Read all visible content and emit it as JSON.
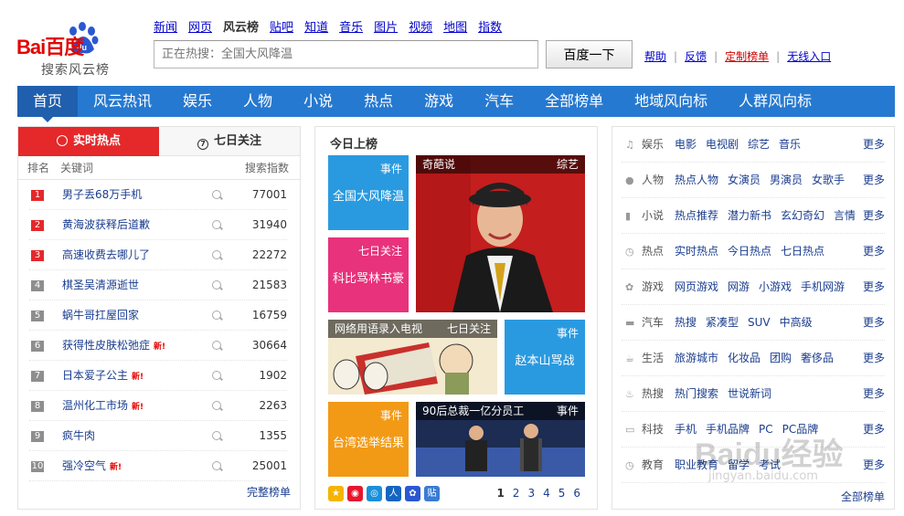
{
  "logo": {
    "word": "Bai百度",
    "sub": "搜索风云榜"
  },
  "topnav": [
    {
      "label": "新闻"
    },
    {
      "label": "网页"
    },
    {
      "label": "风云榜",
      "current": true
    },
    {
      "label": "贴吧"
    },
    {
      "label": "知道"
    },
    {
      "label": "音乐"
    },
    {
      "label": "图片"
    },
    {
      "label": "视频"
    },
    {
      "label": "地图"
    },
    {
      "label": "指数"
    }
  ],
  "search": {
    "placeholder": "正在热搜：全国大风降温",
    "button": "百度一下"
  },
  "toplinks": {
    "help": "帮助",
    "feedback": "反馈",
    "custom": "定制榜单",
    "wireless": "无线入口"
  },
  "mainnav": [
    {
      "label": "首页",
      "current": true
    },
    {
      "label": "风云热讯"
    },
    {
      "label": "娱乐"
    },
    {
      "label": "人物"
    },
    {
      "label": "小说"
    },
    {
      "label": "热点"
    },
    {
      "label": "游戏"
    },
    {
      "label": "汽车"
    },
    {
      "label": "全部榜单"
    },
    {
      "label": "地域风向标"
    },
    {
      "label": "人群风向标"
    }
  ],
  "hot": {
    "tabs": [
      "实时热点",
      "七日关注"
    ],
    "cols": {
      "rank": "排名",
      "keyword": "关键词",
      "index": "搜索指数"
    },
    "new_tag": "新!",
    "rows": [
      {
        "rank": "1",
        "kw": "男子丢68万手机",
        "val": "77001",
        "isNew": false
      },
      {
        "rank": "2",
        "kw": "黄海波获释后道歉",
        "val": "31940",
        "isNew": false
      },
      {
        "rank": "3",
        "kw": "高速收费去哪儿了",
        "val": "22272",
        "isNew": false
      },
      {
        "rank": "4",
        "kw": "棋圣吴清源逝世",
        "val": "21583",
        "isNew": false
      },
      {
        "rank": "5",
        "kw": "蜗牛哥扛屋回家",
        "val": "16759",
        "isNew": false
      },
      {
        "rank": "6",
        "kw": "获得性皮肤松弛症",
        "val": "30664",
        "isNew": true
      },
      {
        "rank": "7",
        "kw": "日本爱子公主",
        "val": "1902",
        "isNew": true
      },
      {
        "rank": "8",
        "kw": "温州化工市场",
        "val": "2263",
        "isNew": true
      },
      {
        "rank": "9",
        "kw": "疯牛肉",
        "val": "1355",
        "isNew": false
      },
      {
        "rank": "10",
        "kw": "强冷空气",
        "val": "25001",
        "isNew": true
      }
    ],
    "more": "完整榜单"
  },
  "today": {
    "title": "今日上榜",
    "tiles": [
      {
        "tag": "事件",
        "text": "全国大风降温",
        "color": "#2a9ae0"
      },
      {
        "tag": "七日关注",
        "text": "科比骂林书豪",
        "color": "#e8327c"
      },
      {
        "tag": "事件",
        "text": "赵本山骂战",
        "color": "#2a9ae0"
      },
      {
        "tag": "事件",
        "text": "台湾选举结果",
        "color": "#f29a16"
      }
    ],
    "photos": [
      {
        "caption": "奇葩说",
        "tag": "综艺"
      },
      {
        "caption": "网络用语录入电视",
        "tag": "七日关注"
      },
      {
        "caption": "90后总裁一亿分员工",
        "tag": "事件"
      }
    ],
    "pages": [
      "1",
      "2",
      "3",
      "4",
      "5",
      "6"
    ]
  },
  "cats": [
    {
      "icon": "♫",
      "name": "娱乐",
      "links": [
        "电影",
        "电视剧",
        "综艺",
        "音乐"
      ]
    },
    {
      "icon": "●",
      "name": "人物",
      "links": [
        "热点人物",
        "女演员",
        "男演员",
        "女歌手"
      ]
    },
    {
      "icon": "▮",
      "name": "小说",
      "links": [
        "热点推荐",
        "潜力新书",
        "玄幻奇幻",
        "言情"
      ]
    },
    {
      "icon": "◷",
      "name": "热点",
      "links": [
        "实时热点",
        "今日热点",
        "七日热点"
      ]
    },
    {
      "icon": "✿",
      "name": "游戏",
      "links": [
        "网页游戏",
        "网游",
        "小游戏",
        "手机网游"
      ]
    },
    {
      "icon": "▬",
      "name": "汽车",
      "links": [
        "热搜",
        "紧凑型",
        "SUV",
        "中高级"
      ]
    },
    {
      "icon": "☕",
      "name": "生活",
      "links": [
        "旅游城市",
        "化妆品",
        "团购",
        "奢侈品"
      ]
    },
    {
      "icon": "♨",
      "name": "热搜",
      "links": [
        "热门搜索",
        "世说新词"
      ]
    },
    {
      "icon": "▭",
      "name": "科技",
      "links": [
        "手机",
        "手机品牌",
        "PC",
        "PC品牌"
      ]
    },
    {
      "icon": "◷",
      "name": "教育",
      "links": [
        "职业教育",
        "留学",
        "考试"
      ]
    }
  ],
  "cats_more": "更多",
  "all_rank": "全部榜单",
  "watermark": {
    "w1": "Baidu经验",
    "w2": "jingyan.baidu.com"
  },
  "colors": {
    "brand_red": "#e10602",
    "nav_blue": "#2679d0",
    "hot_red": "#e5282a"
  }
}
